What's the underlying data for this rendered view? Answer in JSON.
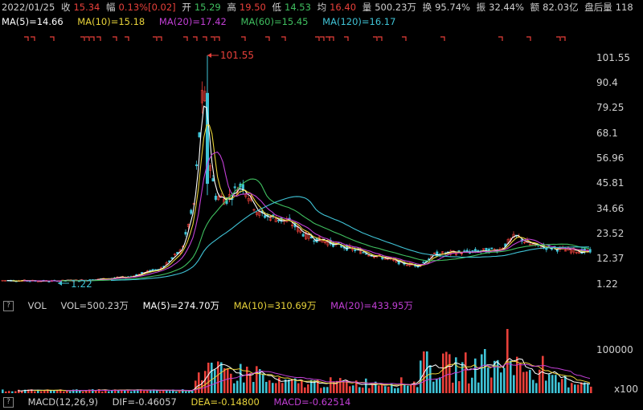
{
  "info": {
    "date": "2022/01/25",
    "close_label": "收",
    "close": "15.34",
    "change_label": "幅",
    "change": "0.13%[0.02]",
    "open_label": "开",
    "open": "15.29",
    "high_label": "高",
    "high": "19.50",
    "low_label": "低",
    "low": "14.53",
    "avg_label": "均",
    "avg": "16.40",
    "volume_label": "量",
    "volume": "500.23万",
    "turnover_label": "换",
    "turnover": "95.74%",
    "amplitude_label": "振",
    "amplitude": "32.44%",
    "amount_label": "额",
    "amount": "82.03亿",
    "after_label": "盘后量",
    "after": "118"
  },
  "ma": {
    "ma5": "MA(5)=14.66",
    "ma10": "MA(10)=15.18",
    "ma20": "MA(20)=17.42",
    "ma60": "MA(60)=15.45",
    "ma120": "MA(120)=16.17"
  },
  "price_axis": [
    "101.55",
    "90.4",
    "79.25",
    "68.1",
    "56.96",
    "45.81",
    "34.66",
    "23.52",
    "12.37",
    "1.22"
  ],
  "annotations": {
    "high": "101.55",
    "low": "1.22"
  },
  "vol": {
    "help": "?",
    "title": "VOL",
    "vol": "VOL=500.23万",
    "ma5": "MA(5)=274.70万",
    "ma10": "MA(10)=310.69万",
    "ma20": "MA(20)=433.95万",
    "axis_top": "100000",
    "axis_unit": "x100"
  },
  "macd": {
    "help": "?",
    "title": "MACD(12,26,9)",
    "dif": "DIF=-0.46057",
    "dea": "DEA=-0.14800",
    "macd": "MACD=-0.62514"
  },
  "colors": {
    "up": "#e8403a",
    "down": "#3fc3d6",
    "ma5": "#ffffff",
    "ma10": "#e8d33a",
    "ma20": "#c23fd6",
    "ma60": "#3fbf5f",
    "ma120": "#3fc3d6"
  }
}
